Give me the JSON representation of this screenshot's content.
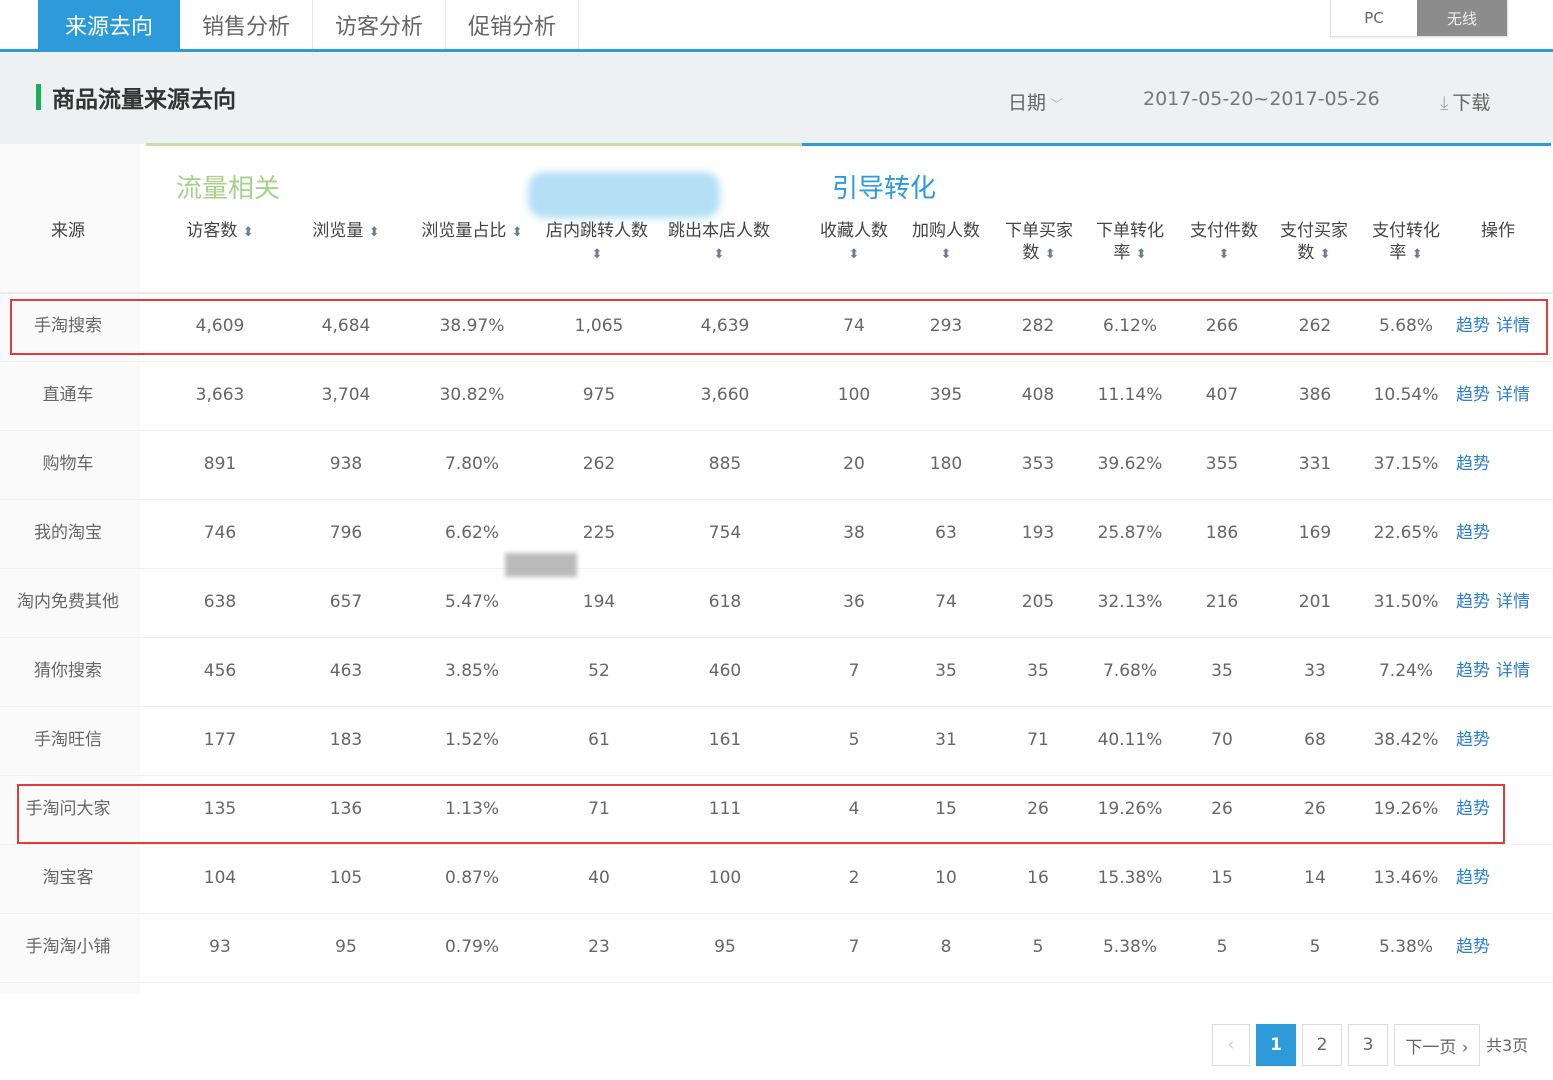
{
  "tabs": [
    "来源去向",
    "销售分析",
    "访客分析",
    "促销分析"
  ],
  "device_toggle": {
    "pc": "PC",
    "wireless": "无线"
  },
  "header": {
    "title": "商品流量来源去向",
    "date_label": "日期",
    "date_range": "2017-05-20~2017-05-26",
    "download": "下载"
  },
  "groups": {
    "traffic": "流量相关",
    "conversion": "引导转化"
  },
  "columns": [
    "来源",
    "访客数",
    "浏览量",
    "浏览量占比",
    "店内跳转人数",
    "跳出本店人数",
    "收藏人数",
    "加购人数",
    "下单买家数",
    "下单转化率",
    "支付件数",
    "支付买家数",
    "支付转化率",
    "操作"
  ],
  "rows": [
    {
      "source": "手淘搜索",
      "values": [
        "4,609",
        "4,684",
        "38.97%",
        "1,065",
        "4,639",
        "74",
        "293",
        "282",
        "6.12%",
        "266",
        "262",
        "5.68%"
      ],
      "ops": [
        "趋势",
        "详情"
      ]
    },
    {
      "source": "直通车",
      "values": [
        "3,663",
        "3,704",
        "30.82%",
        "975",
        "3,660",
        "100",
        "395",
        "408",
        "11.14%",
        "407",
        "386",
        "10.54%"
      ],
      "ops": [
        "趋势",
        "详情"
      ]
    },
    {
      "source": "购物车",
      "values": [
        "891",
        "938",
        "7.80%",
        "262",
        "885",
        "20",
        "180",
        "353",
        "39.62%",
        "355",
        "331",
        "37.15%"
      ],
      "ops": [
        "趋势"
      ]
    },
    {
      "source": "我的淘宝",
      "values": [
        "746",
        "796",
        "6.62%",
        "225",
        "754",
        "38",
        "63",
        "193",
        "25.87%",
        "186",
        "169",
        "22.65%"
      ],
      "ops": [
        "趋势"
      ]
    },
    {
      "source": "淘内免费其他",
      "values": [
        "638",
        "657",
        "5.47%",
        "194",
        "618",
        "36",
        "74",
        "205",
        "32.13%",
        "216",
        "201",
        "31.50%"
      ],
      "ops": [
        "趋势",
        "详情"
      ]
    },
    {
      "source": "猜你搜索",
      "values": [
        "456",
        "463",
        "3.85%",
        "52",
        "460",
        "7",
        "35",
        "35",
        "7.68%",
        "35",
        "33",
        "7.24%"
      ],
      "ops": [
        "趋势",
        "详情"
      ]
    },
    {
      "source": "手淘旺信",
      "values": [
        "177",
        "183",
        "1.52%",
        "61",
        "161",
        "5",
        "31",
        "71",
        "40.11%",
        "70",
        "68",
        "38.42%"
      ],
      "ops": [
        "趋势"
      ]
    },
    {
      "source": "手淘问大家",
      "values": [
        "135",
        "136",
        "1.13%",
        "71",
        "111",
        "4",
        "15",
        "26",
        "19.26%",
        "26",
        "26",
        "19.26%"
      ],
      "ops": [
        "趋势"
      ]
    },
    {
      "source": "淘宝客",
      "values": [
        "104",
        "105",
        "0.87%",
        "40",
        "100",
        "2",
        "10",
        "16",
        "15.38%",
        "15",
        "14",
        "13.46%"
      ],
      "ops": [
        "趋势"
      ]
    },
    {
      "source": "手淘淘小铺",
      "values": [
        "93",
        "95",
        "0.79%",
        "23",
        "95",
        "7",
        "8",
        "5",
        "5.38%",
        "5",
        "5",
        "5.38%"
      ],
      "ops": [
        "趋势"
      ]
    }
  ],
  "pagination": {
    "prev": "‹",
    "pages": [
      "1",
      "2",
      "3"
    ],
    "current": "1",
    "next": "下一页 ›",
    "total": "共3页"
  }
}
